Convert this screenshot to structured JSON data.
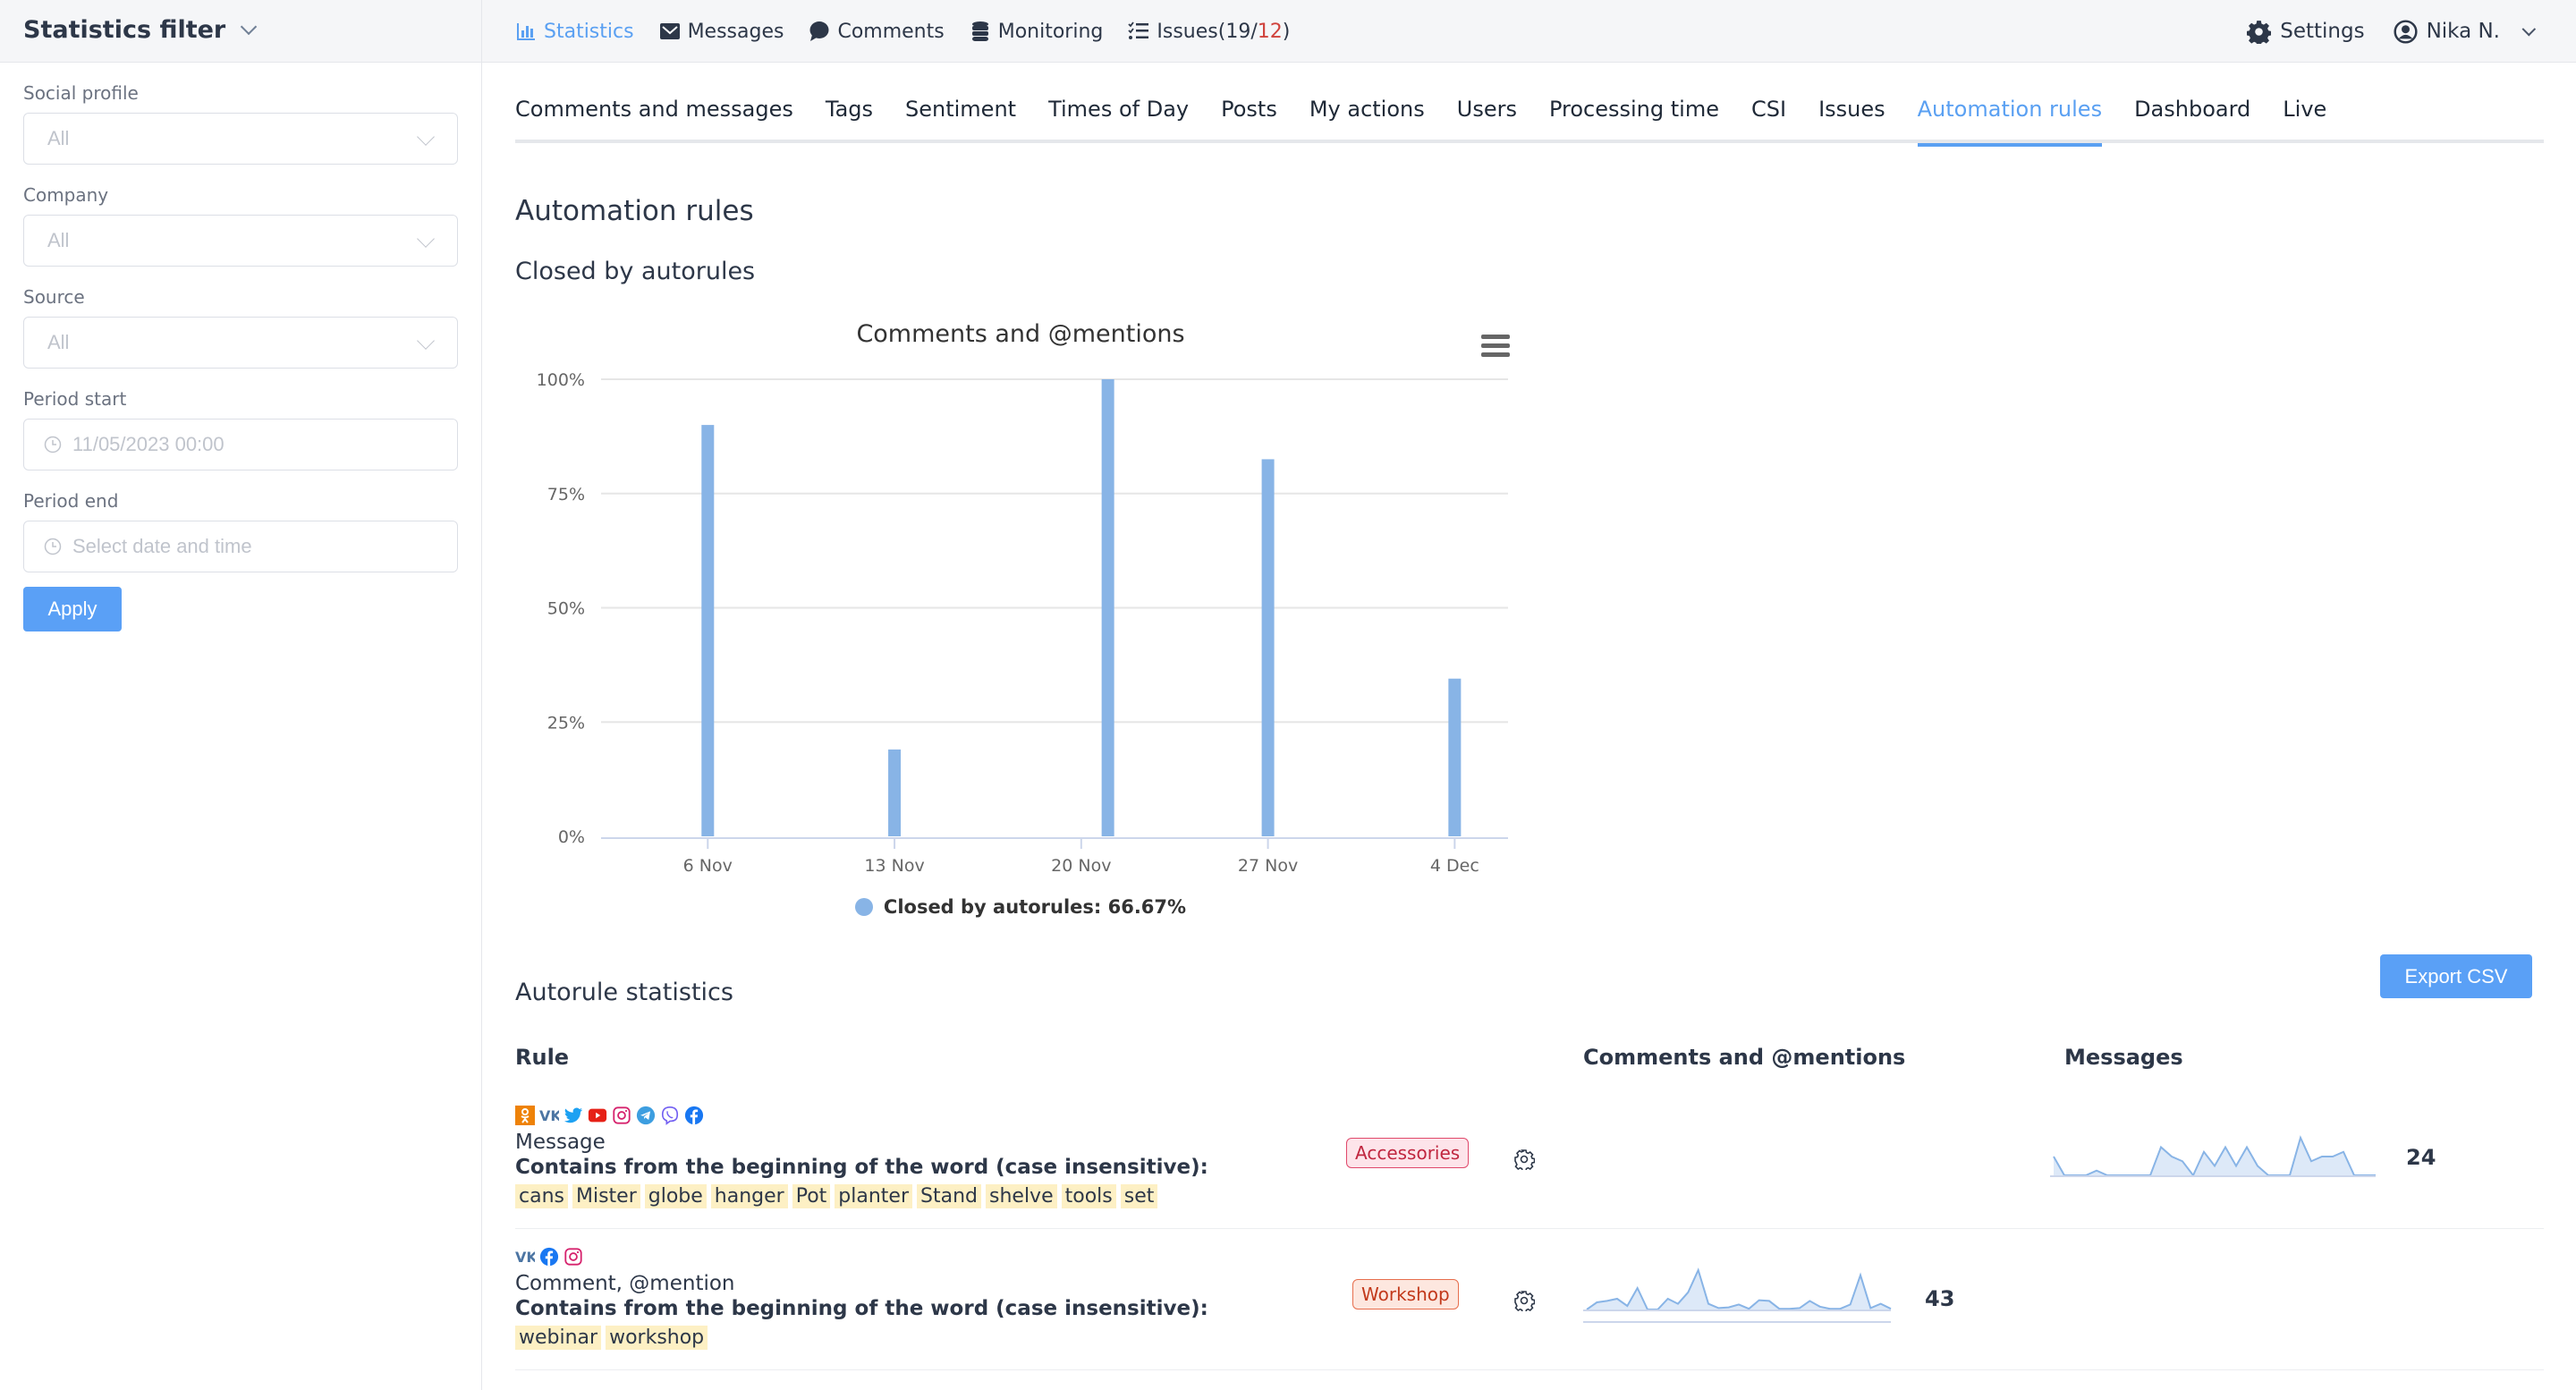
{
  "sidebar": {
    "title": "Statistics filter",
    "fields": [
      {
        "label": "Social profile",
        "value": "All"
      },
      {
        "label": "Company",
        "value": "All"
      },
      {
        "label": "Source",
        "value": "All"
      }
    ],
    "period_start": {
      "label": "Period start",
      "placeholder": "11/05/2023 00:00"
    },
    "period_end": {
      "label": "Period end",
      "placeholder": "Select date and time"
    },
    "apply_label": "Apply"
  },
  "topnav": {
    "items": [
      {
        "label": "Statistics",
        "icon": "bar-chart-icon",
        "active": true
      },
      {
        "label": "Messages",
        "icon": "envelope-icon"
      },
      {
        "label": "Comments",
        "icon": "speech-bubble-icon"
      },
      {
        "label": "Monitoring",
        "icon": "database-icon"
      },
      {
        "label": "Issues",
        "icon": "checklist-icon"
      }
    ],
    "issues_open": "19",
    "issues_overdue": "12",
    "settings_label": "Settings",
    "user_name": "Nika N."
  },
  "tabs": [
    {
      "label": "Comments and messages"
    },
    {
      "label": "Tags"
    },
    {
      "label": "Sentiment"
    },
    {
      "label": "Times of Day"
    },
    {
      "label": "Posts"
    },
    {
      "label": "My actions"
    },
    {
      "label": "Users"
    },
    {
      "label": "Processing time"
    },
    {
      "label": "CSI"
    },
    {
      "label": "Issues"
    },
    {
      "label": "Automation rules",
      "active": true
    },
    {
      "label": "Dashboard"
    },
    {
      "label": "Live"
    }
  ],
  "page": {
    "title": "Automation rules",
    "subtitle": "Closed by autorules",
    "stats_title": "Autorule statistics",
    "export_label": "Export CSV"
  },
  "chart_data": {
    "type": "bar",
    "title": "Comments and @mentions",
    "xlabel": "",
    "ylabel": "",
    "x_ticks": [
      "6 Nov",
      "13 Nov",
      "20 Nov",
      "27 Nov",
      "4 Dec"
    ],
    "y_ticks": [
      "0%",
      "25%",
      "50%",
      "75%",
      "100%"
    ],
    "ylim": [
      0,
      100
    ],
    "grid": true,
    "color": "#88b4e6",
    "legend_position": "bottom",
    "series": [
      {
        "name": "Closed by autorules",
        "legend_label": "Closed by autorules: 66.67%",
        "points": [
          {
            "x": "6 Nov",
            "day_offset": 0,
            "value": 90
          },
          {
            "x": "13 Nov",
            "day_offset": 7,
            "value": 19
          },
          {
            "x": "21 Nov",
            "day_offset": 15,
            "value": 100
          },
          {
            "x": "27 Nov",
            "day_offset": 21,
            "value": 82.5
          },
          {
            "x": "4 Dec",
            "day_offset": 28,
            "value": 34.5
          }
        ]
      }
    ],
    "x_day_range": [
      -4,
      30
    ]
  },
  "table": {
    "headers": {
      "rule": "Rule",
      "comments": "Comments and @mentions",
      "messages": "Messages"
    },
    "rows": [
      {
        "networks": [
          "odnoklassniki-icon",
          "vk-icon",
          "twitter-icon",
          "youtube-icon",
          "instagram-icon",
          "telegram-icon",
          "viber-icon",
          "facebook-icon"
        ],
        "type": "Message",
        "condition": "Contains from the beginning of the word (case insensitive):",
        "keywords": [
          "cans",
          "Mister",
          "globe",
          "hanger",
          "Pot",
          "planter",
          "Stand",
          "shelve",
          "tools",
          "set"
        ],
        "tag": "Accessories",
        "comments_count": null,
        "messages_count": "24",
        "messages_spark": [
          2,
          0,
          0,
          0,
          0.5,
          0,
          0,
          0,
          0,
          0,
          3,
          2,
          1.5,
          0,
          2.5,
          1,
          3,
          1,
          3,
          1,
          0,
          0,
          0,
          4,
          1.5,
          2,
          2,
          2.5,
          0,
          0,
          0
        ]
      },
      {
        "networks": [
          "vk-icon",
          "facebook-icon",
          "instagram-icon"
        ],
        "type": "Comment, @mention",
        "condition": "Contains from the beginning of the word (case insensitive):",
        "keywords": [
          "webinar",
          "workshop"
        ],
        "tag": "Workshop",
        "comments_count": "43",
        "comments_spark": [
          0,
          1,
          1.2,
          1.5,
          0.5,
          3,
          0,
          0,
          1.5,
          0.8,
          2.4,
          5.5,
          0.8,
          0.2,
          0.3,
          0.7,
          0.1,
          1.3,
          1.2,
          0.1,
          0.1,
          0.2,
          1.2,
          0.4,
          0.1,
          0.1,
          0.7,
          4.8,
          0.2,
          0.8,
          0.1
        ],
        "messages_count": null
      }
    ]
  }
}
